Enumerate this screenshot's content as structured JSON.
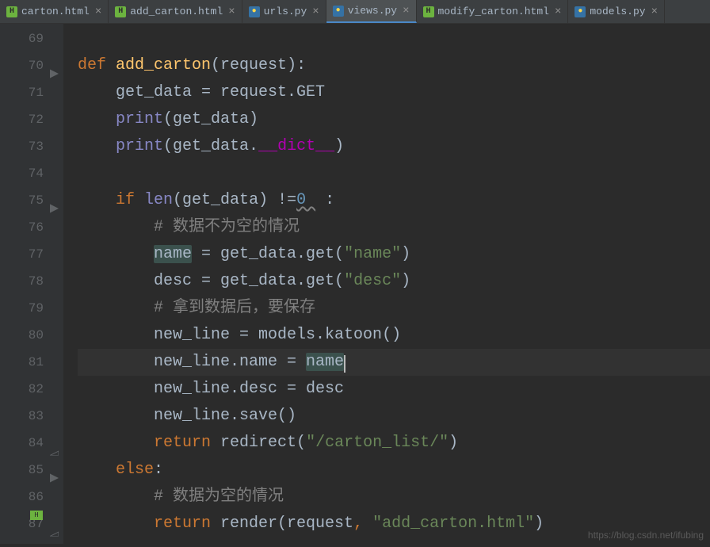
{
  "tabs": [
    {
      "icon": "html",
      "label": "carton.html",
      "active": false
    },
    {
      "icon": "html",
      "label": "add_carton.html",
      "active": false
    },
    {
      "icon": "py",
      "label": "urls.py",
      "active": false
    },
    {
      "icon": "py",
      "label": "views.py",
      "active": true
    },
    {
      "icon": "html",
      "label": "modify_carton.html",
      "active": false
    },
    {
      "icon": "py",
      "label": "models.py",
      "active": false
    }
  ],
  "line_numbers": [
    "69",
    "70",
    "71",
    "72",
    "73",
    "74",
    "75",
    "76",
    "77",
    "78",
    "79",
    "80",
    "81",
    "82",
    "83",
    "84",
    "85",
    "86",
    "87"
  ],
  "code": {
    "l70_def": "def ",
    "l70_fn": "add_carton",
    "l70_rest": "(request):",
    "l71_a": "    get_data = request.GET",
    "l72_a": "    ",
    "l72_print": "print",
    "l72_b": "(get_data)",
    "l73_a": "    ",
    "l73_print": "print",
    "l73_b": "(get_data.",
    "l73_dict": "__dict__",
    "l73_c": ")",
    "l75_a": "    ",
    "l75_if": "if ",
    "l75_len": "len",
    "l75_b": "(get_data) !=",
    "l75_num": "0 ",
    "l75_c": " :",
    "l76_indent": "        ",
    "l76_comment": "# 数据不为空的情况",
    "l77_indent": "        ",
    "l77_name": "name",
    "l77_rest": " = get_data.get(",
    "l77_str": "\"name\"",
    "l77_end": ")",
    "l78_indent": "        ",
    "l78_a": "desc = get_data.get(",
    "l78_str": "\"desc\"",
    "l78_end": ")",
    "l79_indent": "        ",
    "l79_comment": "# 拿到数据后，要保存",
    "l80_indent": "        ",
    "l80_a": "new_line = models.katoon()",
    "l81_indent": "        ",
    "l81_a": "new_line.name = ",
    "l81_name": "name",
    "l82_indent": "        ",
    "l82_a": "new_line.desc = desc",
    "l83_indent": "        ",
    "l83_a": "new_line.save()",
    "l84_indent": "        ",
    "l84_return": "return ",
    "l84_fn": "redirect(",
    "l84_str": "\"/carton_list/\"",
    "l84_end": ")",
    "l85_indent": "    ",
    "l85_else": "else",
    "l85_colon": ":",
    "l86_indent": "        ",
    "l86_comment": "# 数据为空的情况",
    "l87_indent": "        ",
    "l87_return": "return ",
    "l87_fn": "render(request",
    "l87_comma": ", ",
    "l87_str": "\"add_carton.html\"",
    "l87_end": ")"
  },
  "watermark": "https://blog.csdn.net/ifubing"
}
